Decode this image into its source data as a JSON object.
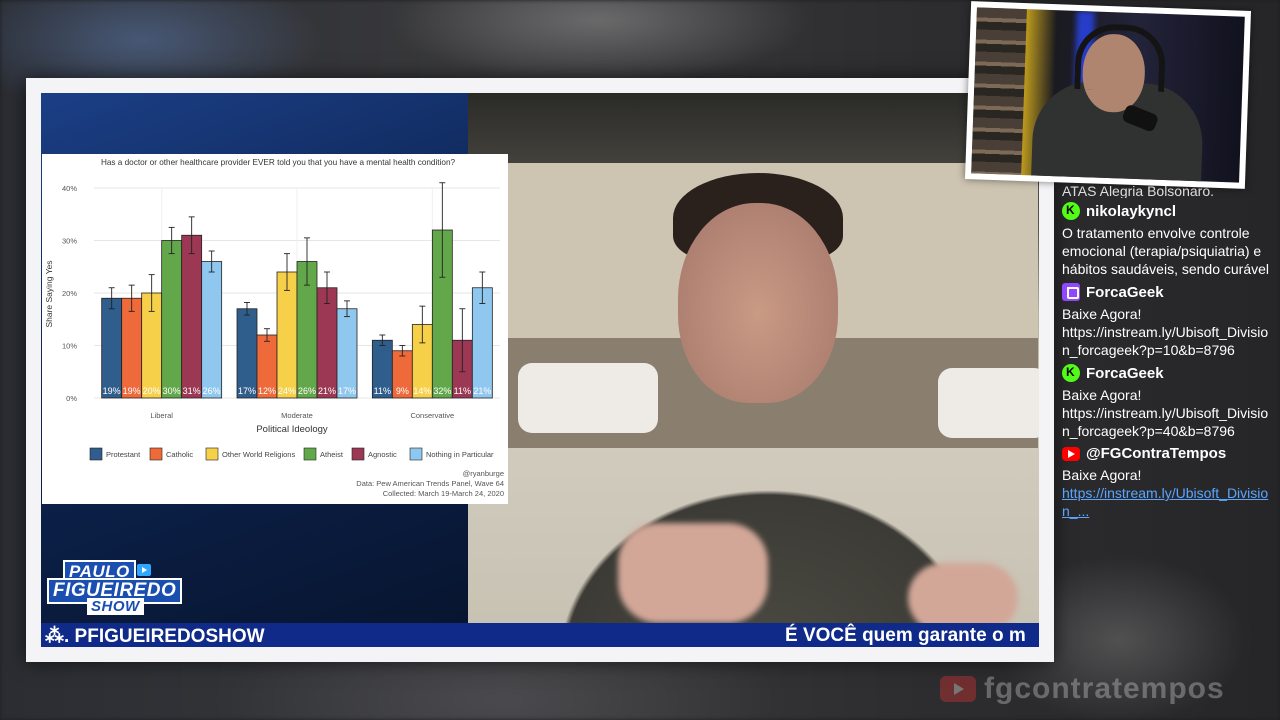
{
  "ticker": {
    "handle": "⁂. PFIGUEIREDOSHOW",
    "message": "É VOCÊ quem garante o m"
  },
  "logo": {
    "line1": "PAULO",
    "line2": "FIGUEIREDO",
    "line3": "SHOW"
  },
  "chart_data": {
    "type": "bar",
    "title": "Has a doctor or other healthcare provider EVER told you that you have a mental health condition?",
    "xlabel": "Political Ideology",
    "ylabel": "Share Saying Yes",
    "ylim": [
      0,
      40
    ],
    "yticks": [
      "0%",
      "10%",
      "20%",
      "30%",
      "40%"
    ],
    "categories": [
      "Liberal",
      "Moderate",
      "Conservative"
    ],
    "series": [
      {
        "name": "Protestant",
        "color": "#2f5d8c",
        "values": [
          19,
          17,
          11
        ],
        "labels": [
          "19%",
          "17%",
          "11%"
        ],
        "err": [
          2,
          1.2,
          1
        ]
      },
      {
        "name": "Catholic",
        "color": "#ef6a3a",
        "values": [
          19,
          12,
          9
        ],
        "labels": [
          "19%",
          "12%",
          "9%"
        ],
        "err": [
          2.5,
          1.2,
          1
        ]
      },
      {
        "name": "Other World Religions",
        "color": "#f7d04a",
        "values": [
          20,
          24,
          14
        ],
        "labels": [
          "20%",
          "24%",
          "14%"
        ],
        "err": [
          3.5,
          3.5,
          3.5
        ]
      },
      {
        "name": "Atheist",
        "color": "#62a84a",
        "values": [
          30,
          26,
          32
        ],
        "labels": [
          "30%",
          "26%",
          "32%"
        ],
        "err": [
          2.5,
          4.5,
          9
        ]
      },
      {
        "name": "Agnostic",
        "color": "#9c3853",
        "values": [
          31,
          21,
          11
        ],
        "labels": [
          "31%",
          "21%",
          "11%"
        ],
        "err": [
          3.5,
          3,
          6
        ]
      },
      {
        "name": "Nothing in Particular",
        "color": "#8fc7ef",
        "values": [
          26,
          17,
          21
        ],
        "labels": [
          "26%",
          "17%",
          "21%"
        ],
        "err": [
          2,
          1.5,
          3
        ]
      }
    ],
    "credit": "@ryanburge",
    "source": "Data: Pew American Trends Panel, Wave 64",
    "collected": "Collected: March 19-March 24, 2020"
  },
  "chat": {
    "cut_line": "ATAS Alegria Bolsonaro.",
    "messages": [
      {
        "platform": "kick",
        "user": "nikolaykyncl",
        "text": "O tratamento envolve controle emocional (terapia/psiquiatria) e hábitos saudáveis, sendo curável",
        "link": ""
      },
      {
        "platform": "twitch",
        "user": "ForcaGeek",
        "text": "Baixe Agora! https://instream.ly/Ubisoft_Division_forcageek?p=10&b=8796",
        "link": ""
      },
      {
        "platform": "kick",
        "user": "ForcaGeek",
        "text": "Baixe Agora! https://instream.ly/Ubisoft_Division_forcageek?p=40&b=8796",
        "link": ""
      },
      {
        "platform": "youtube",
        "user": "@FGContraTempos",
        "text": "Baixe Agora!",
        "link": "https://instream.ly/Ubisoft_Division_..."
      }
    ]
  },
  "watermark": {
    "text": "fgcontratempos"
  }
}
